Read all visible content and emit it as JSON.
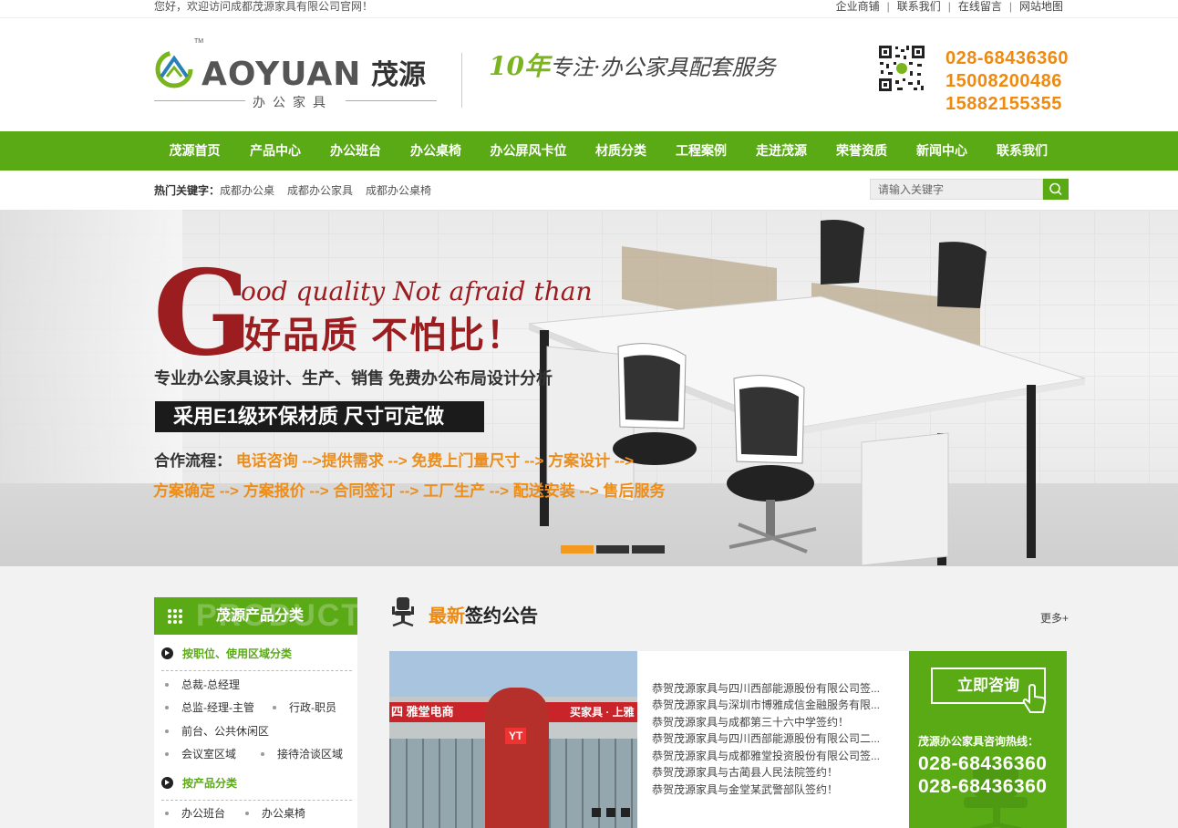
{
  "topbar": {
    "welcome": "您好，欢迎访问成都茂源家具有限公司官网！",
    "links": [
      "企业商铺",
      "联系我们",
      "在线留言",
      "网站地图"
    ],
    "sep": "|"
  },
  "header": {
    "logo_text": "AOYUAN",
    "logo_cn": "茂源",
    "logo_sub": "办公家具",
    "logo_tm": "TM",
    "slogan_num": "10年",
    "slogan_text": "专注·办公家具配套服务",
    "phones": [
      "028-68436360",
      "15008200486",
      "15882155355"
    ]
  },
  "nav": [
    "茂源首页",
    "产品中心",
    "办公班台",
    "办公桌椅",
    "办公屏风卡位",
    "材质分类",
    "工程案例",
    "走进茂源",
    "荣誉资质",
    "新闻中心",
    "联系我们"
  ],
  "hot": {
    "label": "热门关键字：",
    "keywords": [
      "成都办公桌",
      "成都办公家具",
      "成都办公桌椅"
    ]
  },
  "search": {
    "placeholder": "请输入关键字"
  },
  "banner": {
    "big_letter": "G",
    "english": "ood quality Not afraid than",
    "slogan": "好品质  不怕比！",
    "line1": "专业办公家具设计、生产、销售  免费办公布局设计分析",
    "black_bar": "采用E1级环保材质  尺寸可定做",
    "flow_label": "合作流程：",
    "flow1": "电话咨询 -->提供需求 --> 免费上门量尺寸 --> 方案设计 -->",
    "flow2": "方案确定 --> 方案报价 --> 合同签订 --> 工厂生产 --> 配送安装 --> 售后服务",
    "slides": 3,
    "active_slide": 1
  },
  "sidebar": {
    "ghost": "PRODUCT",
    "title": "茂源产品分类",
    "cat1": "按职位、使用区域分类",
    "cat1_items": [
      "总裁-总经理",
      "总监-经理-主管",
      "行政-职员",
      "前台、公共休闲区",
      "会议室区域",
      "接待洽谈区域"
    ],
    "cat2": "按产品分类",
    "cat2_items": [
      "办公班台",
      "办公桌椅"
    ]
  },
  "news": {
    "title_hl": "最新",
    "title_rest": "签约公告",
    "more": "更多+",
    "photo_sign_left": "四 雅堂电商",
    "photo_sign_right": "买家具 · 上雅",
    "photo_tower": "YT",
    "items": [
      "恭贺茂源家具与四川西部能源股份有限公司签...",
      "恭贺茂源家具与深圳市博雅成信金融服务有限...",
      "恭贺茂源家具与成都第三十六中学签约！",
      "恭贺茂源家具与四川西部能源股份有限公司二...",
      "恭贺茂源家具与成都雅堂投资股份有限公司签...",
      "恭贺茂源家具与古蔺县人民法院签约！",
      "恭贺茂源家具与金堂某武警部队签约！"
    ]
  },
  "consult": {
    "button": "立即咨询",
    "hotline_label": "茂源办公家具咨询热线：",
    "tels": [
      "028-68436360",
      "028-68436360"
    ]
  },
  "colors": {
    "green": "#5aaa16",
    "orange": "#ee8a10",
    "red": "#9b1d20"
  }
}
